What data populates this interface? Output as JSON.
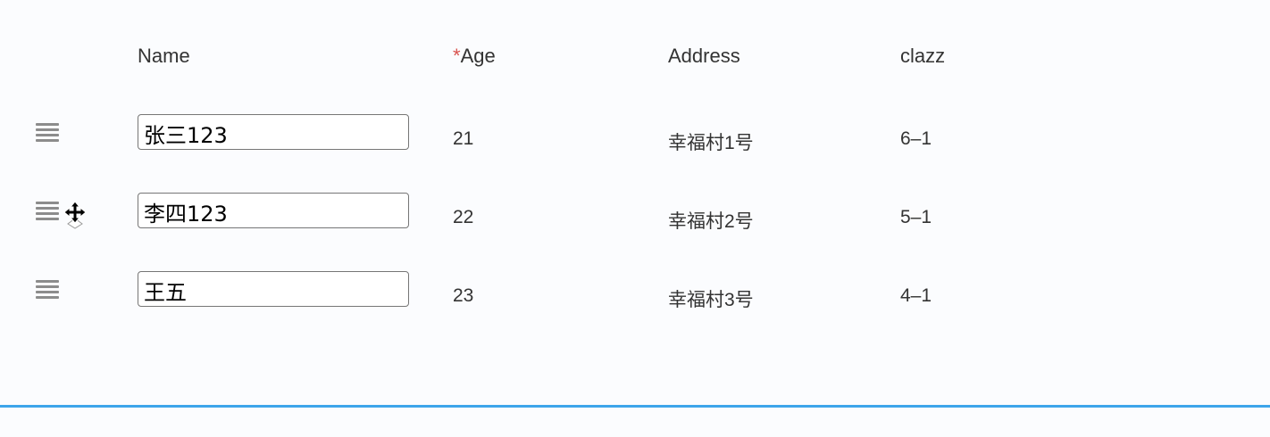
{
  "table": {
    "headers": {
      "name": "Name",
      "age_required_mark": "*",
      "age": "Age",
      "address": "Address",
      "clazz": "clazz"
    },
    "rows": [
      {
        "name": "张三123",
        "age": "21",
        "address": "幸福村1号",
        "clazz": "6–1"
      },
      {
        "name": "李四123",
        "age": "22",
        "address": "幸福村2号",
        "clazz": "5–1"
      },
      {
        "name": "王五",
        "age": "23",
        "address": "幸福村3号",
        "clazz": "4–1"
      }
    ]
  },
  "icons": {
    "drag_handle": "drag-handle-icon",
    "cursor": "move-cursor-icon"
  },
  "colors": {
    "required_mark": "#d9534f",
    "bottom_border": "#3da5ea",
    "background": "#fbfcfe"
  }
}
